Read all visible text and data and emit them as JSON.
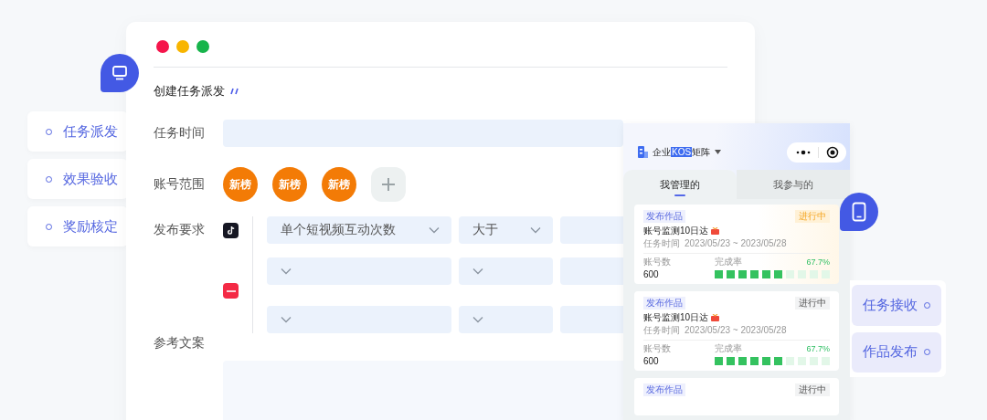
{
  "left_menu": {
    "items": [
      "任务派发",
      "效果验收",
      "奖励核定"
    ]
  },
  "form": {
    "title": "创建任务派发",
    "time": {
      "label": "任务时间"
    },
    "accounts": {
      "label": "账号范围",
      "avatars": [
        "新榜",
        "新榜",
        "新榜"
      ]
    },
    "requirements": {
      "label": "发布要求",
      "rows": [
        {
          "kind": "note",
          "selects": [
            "单个短视频互动次数",
            "大于"
          ]
        },
        {
          "kind": "book"
        },
        {
          "kind": "blank"
        }
      ]
    },
    "copy": {
      "label": "参考文案"
    }
  },
  "phone": {
    "brand_prefix": "企业",
    "brand_highlight": "KOS",
    "brand_suffix": "矩阵",
    "tabs": [
      {
        "label": "我管理的",
        "selected": true
      },
      {
        "label": "我参与的",
        "selected": false
      }
    ],
    "cards": [
      {
        "tag": "发布作品",
        "status": "进行中",
        "highlighted": true,
        "title": "账号监测10日达",
        "time_label": "任务时间",
        "time": "2023/05/23 ~ 2023/05/28",
        "count_label": "账号数",
        "count": "600",
        "rate_label": "完成率",
        "rate": "67.7%",
        "level": 0.6
      },
      {
        "tag": "发布作品",
        "status": "进行中",
        "highlighted": false,
        "title": "账号监测10日达",
        "time_label": "任务时间",
        "time": "2023/05/23 ~ 2023/05/28",
        "count_label": "账号数",
        "count": "600",
        "rate_label": "完成率",
        "rate": "67.7%",
        "level": 0.6
      },
      {
        "tag": "发布作品",
        "status": "进行中",
        "highlighted": false
      }
    ]
  },
  "right_menu": {
    "items": [
      "任务接收",
      "作品发布"
    ]
  }
}
